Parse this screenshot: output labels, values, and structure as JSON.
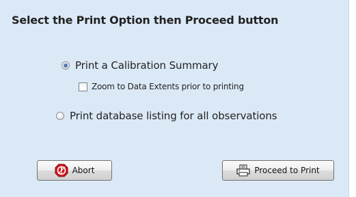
{
  "dialog": {
    "title": "Select the Print Option then Proceed button",
    "options": {
      "calibration_summary": {
        "label": "Print a Calibration Summary",
        "selected": true
      },
      "zoom_extents": {
        "label": "Zoom to Data Extents prior to printing",
        "checked": false
      },
      "database_listing": {
        "label": "Print database listing for all observations",
        "selected": false
      }
    },
    "buttons": {
      "abort_label": "Abort",
      "proceed_label": "Proceed to Print"
    },
    "icons": {
      "abort": "stop-sign-icon",
      "proceed": "printer-icon"
    },
    "colors": {
      "background": "#dbe9f7",
      "abort_icon": "#d0151b"
    }
  }
}
